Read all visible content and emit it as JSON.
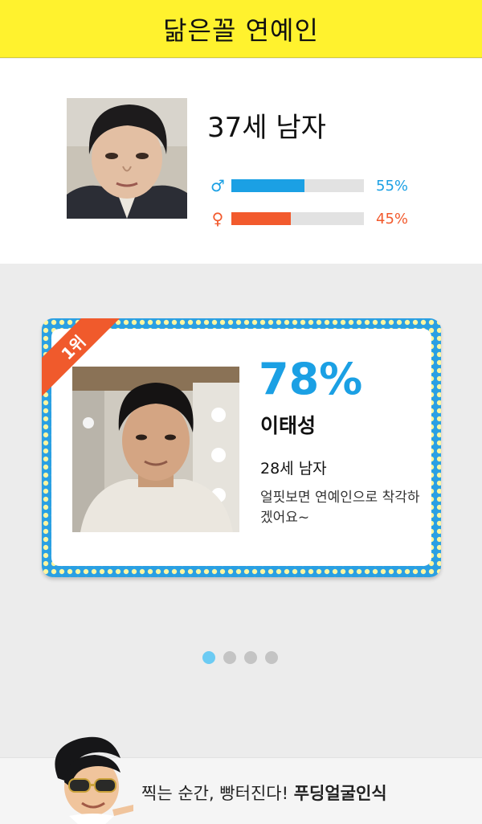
{
  "header": {
    "title": "닮은꼴 연예인"
  },
  "user": {
    "age_label": "37세 남자",
    "male": {
      "symbol": "♂",
      "percent_label": "55%",
      "percent": 55,
      "color": "#1ba0e4"
    },
    "female": {
      "symbol": "♀",
      "percent_label": "45%",
      "percent": 45,
      "color": "#f25a2d"
    }
  },
  "result": {
    "rank_badge": "1위",
    "match_percent": "78%",
    "celebrity_name": "이태성",
    "celebrity_info": "28세 남자",
    "comment": "얼핏보면 연예인으로 착각하겠어요~"
  },
  "pagination": {
    "total": 4,
    "active_index": 0
  },
  "banner": {
    "slogan_text": "찍는 순간, 빵터진다! ",
    "slogan_brand": "푸딩얼굴인식"
  },
  "colors": {
    "header_bg": "#fff22e",
    "accent_blue": "#1ba0e4",
    "accent_orange": "#f25a2d",
    "card_dots": "#fff6a0"
  }
}
